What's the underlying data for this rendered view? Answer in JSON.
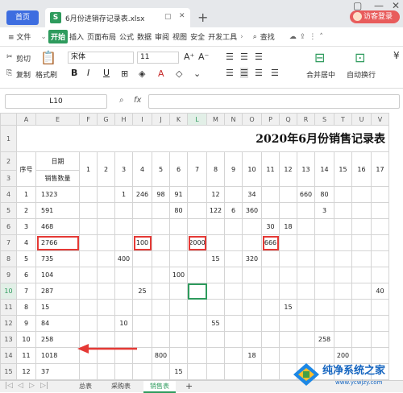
{
  "tabs": {
    "home": "首页",
    "file": "6月份进销存记录表.xlsx",
    "plus": "+",
    "login": "访客登录"
  },
  "menu": {
    "file": "≡ 文件",
    "items": [
      "开始",
      "插入",
      "页面布局",
      "公式",
      "数据",
      "审阅",
      "视图",
      "安全",
      "开发工具"
    ],
    "active": "开始",
    "search": "查找"
  },
  "ribbon": {
    "cut": "剪切",
    "copy": "复制",
    "format_painter": "格式刷",
    "paste": "粘贴",
    "font": "宋体",
    "size": "11",
    "bold": "B",
    "italic": "I",
    "underline": "U",
    "merge": "合并居中",
    "wrap": "自动换行",
    "grow": "A⁺",
    "shrink": "A⁻"
  },
  "formula": {
    "cell": "L10",
    "fx": "fx"
  },
  "sheet": {
    "title": "2020年6月份销售记录表",
    "columns": [
      "A",
      "E",
      "F",
      "G",
      "H",
      "I",
      "J",
      "K",
      "L",
      "M",
      "N",
      "O",
      "P",
      "Q",
      "R",
      "S",
      "T",
      "U",
      "V"
    ],
    "row_numbers": [
      "1",
      "2",
      "3",
      "4",
      "5",
      "6",
      "7",
      "8",
      "9",
      "10",
      "11",
      "12",
      "13",
      "14",
      "15"
    ],
    "hdr_date": "日期",
    "hdr_seq": "序号",
    "hdr_qty": "销售数量",
    "days": [
      "1",
      "2",
      "3",
      "4",
      "5",
      "6",
      "7",
      "8",
      "9",
      "10",
      "11",
      "12",
      "13",
      "14",
      "15",
      "16",
      "17"
    ],
    "rows": [
      [
        "1",
        "1323",
        "",
        "",
        "1",
        "246",
        "98",
        "91",
        "",
        "12",
        "",
        "34",
        "",
        "",
        "660",
        "80",
        "",
        "",
        ""
      ],
      [
        "2",
        "591",
        "",
        "",
        "",
        "",
        "",
        "80",
        "",
        "122",
        "6",
        "360",
        "",
        "",
        "",
        "3",
        "",
        "",
        ""
      ],
      [
        "3",
        "468",
        "",
        "",
        "",
        "",
        "",
        "",
        "",
        "",
        "",
        "",
        "30",
        "18",
        "",
        "",
        "",
        "",
        ""
      ],
      [
        "4",
        "2766",
        "",
        "",
        "",
        "100",
        "",
        "",
        "2000",
        "",
        "",
        "",
        "666",
        "",
        "",
        "",
        "",
        "",
        ""
      ],
      [
        "5",
        "735",
        "",
        "",
        "400",
        "",
        "",
        "",
        "",
        "15",
        "",
        "320",
        "",
        "",
        "",
        "",
        "",
        "",
        ""
      ],
      [
        "6",
        "104",
        "",
        "",
        "",
        "",
        "",
        "100",
        "",
        "",
        "",
        "",
        "",
        "",
        "",
        "",
        "",
        "",
        ""
      ],
      [
        "7",
        "287",
        "",
        "",
        "",
        "25",
        "",
        "",
        "",
        "",
        "",
        "",
        "",
        "",
        "",
        "",
        "",
        "",
        "40"
      ],
      [
        "8",
        "15",
        "",
        "",
        "",
        "",
        "",
        "",
        "",
        "",
        "",
        "",
        "",
        "15",
        "",
        "",
        "",
        "",
        ""
      ],
      [
        "9",
        "84",
        "",
        "",
        "10",
        "",
        "",
        "",
        "",
        "55",
        "",
        "",
        "",
        "",
        "",
        "",
        "",
        "",
        ""
      ],
      [
        "10",
        "258",
        "",
        "",
        "",
        "",
        "",
        "",
        "",
        "",
        "",
        "",
        "",
        "",
        "",
        "258",
        "",
        "",
        ""
      ],
      [
        "11",
        "1018",
        "",
        "",
        "",
        "",
        "800",
        "",
        "",
        "",
        "",
        "18",
        "",
        "",
        "",
        "",
        "200",
        "",
        ""
      ],
      [
        "12",
        "37",
        "",
        "",
        "",
        "",
        "",
        "15",
        "",
        "",
        "",
        "",
        "",
        "",
        "",
        "",
        "",
        "",
        ""
      ]
    ]
  },
  "sheet_tabs": [
    "总表",
    "采购表",
    "销售表",
    "+"
  ],
  "active_sheet": "销售表",
  "watermark": {
    "name": "纯净系统之家",
    "url": "www.ycwjzy.com"
  }
}
